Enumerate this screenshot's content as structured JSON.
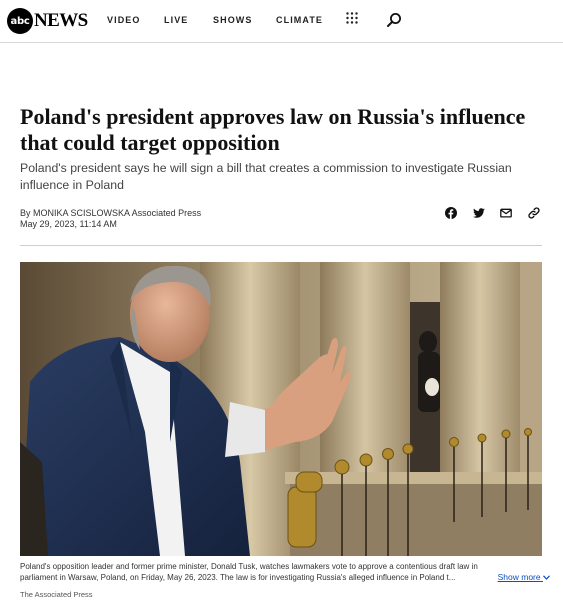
{
  "brand": {
    "badge": "abc",
    "word": "NEWS"
  },
  "nav": {
    "links": [
      "VIDEO",
      "LIVE",
      "SHOWS",
      "CLIMATE"
    ],
    "grid_icon": "grid-icon",
    "search_icon": "search-icon"
  },
  "article": {
    "headline": "Poland's president approves law on Russia's influence that could target opposition",
    "deck": "Poland's president says he will sign a bill that creates a commission to investigate Russian influence in Poland",
    "byline_prefix": "By",
    "author": "MONIKA SCISLOWSKA",
    "agency": "Associated Press",
    "date": "May 29, 2023, 11:14 AM"
  },
  "share": [
    "facebook-icon",
    "twitter-icon",
    "email-icon",
    "link-icon"
  ],
  "photo": {
    "caption_line1": "Poland's opposition leader and former prime minister, Donald Tusk, watches lawmakers vote to approve a contentious draft law in",
    "caption_line2": "parliament in Warsaw, Poland, on Friday, May 26, 2023. The law is for investigating Russia's alleged influence in Poland t...",
    "show_more": "Show more",
    "credit": "The Associated Press"
  },
  "colors": {
    "link": "#0a4fc4",
    "text": "#111111"
  }
}
